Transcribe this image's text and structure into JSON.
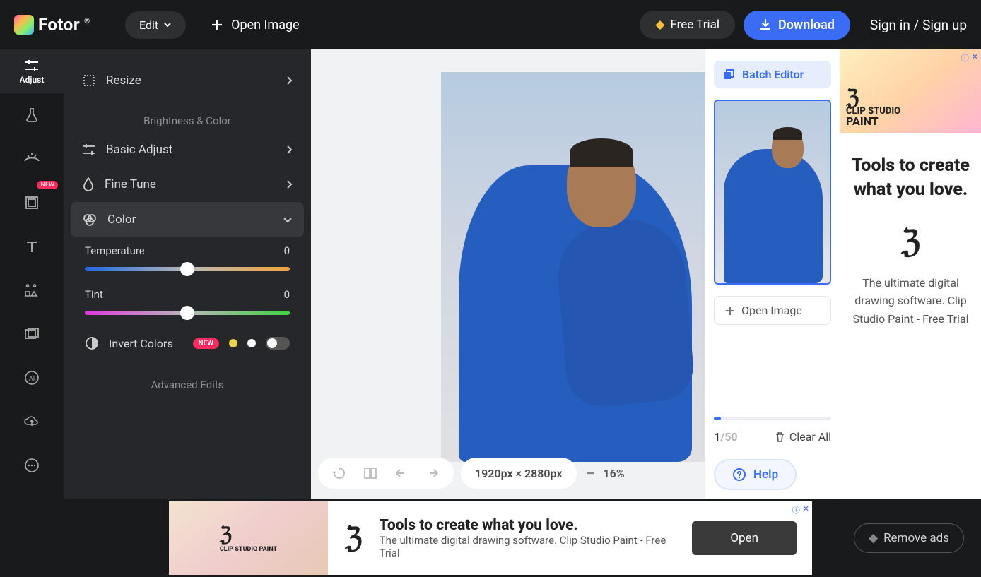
{
  "brand": "Fotor",
  "topbar": {
    "edit_label": "Edit",
    "open_image_label": "Open Image",
    "free_trial_label": "Free Trial",
    "download_label": "Download",
    "sign_label": "Sign in / Sign up"
  },
  "rail": {
    "items": [
      "Adjust"
    ],
    "new_badge": "NEW"
  },
  "panel": {
    "resize": "Resize",
    "section_brightness": "Brightness & Color",
    "basic_adjust": "Basic Adjust",
    "fine_tune": "Fine Tune",
    "color": "Color",
    "temperature_label": "Temperature",
    "temperature_value": "0",
    "tint_label": "Tint",
    "tint_value": "0",
    "invert_label": "Invert Colors",
    "new_tag": "NEW",
    "section_advanced": "Advanced Edits"
  },
  "canvas": {
    "dims": "1920px × 2880px",
    "zoom": "16%"
  },
  "batch": {
    "button": "Batch Editor",
    "open_image": "Open Image",
    "count_current": "1",
    "count_total": "/50",
    "clear_all": "Clear All",
    "help": "Help"
  },
  "ad_side": {
    "brand1": "CLIP STUDIO",
    "brand2": "PAINT",
    "headline": "Tools to create what you love.",
    "desc": "The ultimate digital drawing software. Clip Studio Paint - Free Trial",
    "info": "ⓘ",
    "close": "✕"
  },
  "ad_bottom": {
    "headline": "Tools to create what you love.",
    "desc": "The ultimate digital drawing software. Clip Studio Paint - Free Trial",
    "open": "Open",
    "info": "ⓘ",
    "close": "✕",
    "remove_ads": "Remove ads",
    "brand": "CLIP STUDIO PAINT"
  }
}
